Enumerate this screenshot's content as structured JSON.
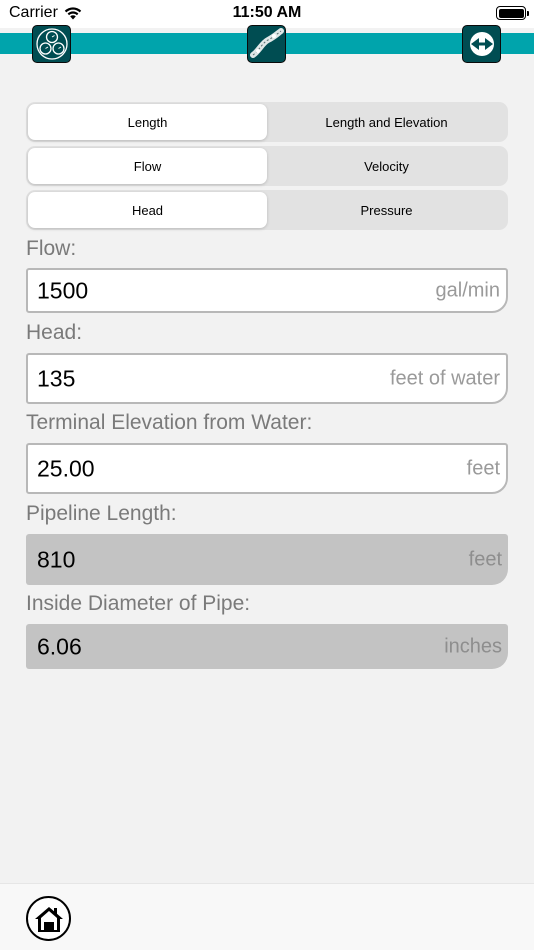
{
  "status_bar": {
    "carrier": "Carrier",
    "time": "11:50 AM"
  },
  "nav": {
    "accent_color": "#00a4ac",
    "icons": [
      "circles-icon",
      "pipeline-icon",
      "pump-icon"
    ]
  },
  "segments": {
    "mode": {
      "options": [
        "Length",
        "Length and Elevation"
      ],
      "selected": "Length"
    },
    "flow_type": {
      "options": [
        "Flow",
        "Velocity"
      ],
      "selected": "Flow"
    },
    "head_type": {
      "options": [
        "Head",
        "Pressure"
      ],
      "selected": "Head"
    }
  },
  "fields": {
    "flow": {
      "label": "Flow:",
      "value": "1500",
      "unit": "gal/min"
    },
    "head": {
      "label": "Head:",
      "value": "135",
      "unit": "feet of water"
    },
    "terminal_elevation": {
      "label": "Terminal Elevation from Water:",
      "value": "25.00",
      "unit": "feet"
    },
    "pipeline_length": {
      "label": "Pipeline Length:",
      "value": "810",
      "unit": "feet"
    },
    "inside_diameter": {
      "label": "Inside Diameter of Pipe:",
      "value": "6.06",
      "unit": "inches"
    }
  },
  "tab_bar": {
    "icons": [
      "home-icon"
    ]
  }
}
